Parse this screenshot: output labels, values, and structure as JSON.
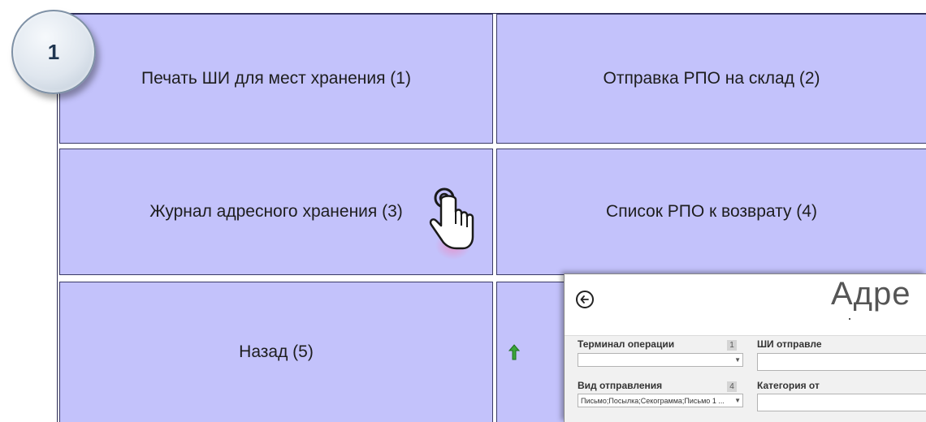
{
  "step": {
    "number": "1"
  },
  "menu": {
    "buttons": [
      {
        "label": "Печать ШИ для мест хранения (1)"
      },
      {
        "label": "Отправка РПО на склад (2)"
      },
      {
        "label": "Журнал адресного хранения (3)"
      },
      {
        "label": "Список РПО к возврату (4)"
      },
      {
        "label": "Назад (5)"
      }
    ]
  },
  "overlay": {
    "title": "Адре",
    "fields": {
      "terminal_label": "Терминал операции",
      "terminal_num": "1",
      "terminal_value": "",
      "barcode_label": "ШИ отправле",
      "mail_type_label": "Вид отправления",
      "mail_type_num": "4",
      "mail_type_value": "Письмо;Посылка;Секограмма;Письмо 1 ...",
      "category_label": "Категория от"
    }
  },
  "colors": {
    "button_bg": "#c3c2fb",
    "accent_arrow": "#3aa53a"
  }
}
